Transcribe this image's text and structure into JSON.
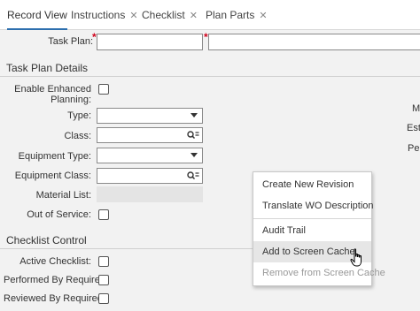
{
  "tabs": [
    {
      "label": "Record View",
      "active": true,
      "closable": false
    },
    {
      "label": "Instructions",
      "closable": true
    },
    {
      "label": "Checklist",
      "closable": true
    },
    {
      "label": "Plan Parts",
      "closable": true
    }
  ],
  "close_glyph": "✕",
  "task_plan": {
    "label": "Task Plan:",
    "required_mark": "*"
  },
  "sections": {
    "details": "Task Plan Details",
    "checklist": "Checklist Control"
  },
  "details": {
    "enable_enhanced": "Enable Enhanced Planning:",
    "type": "Type:",
    "class": "Class:",
    "equipment_type": "Equipment Type:",
    "equipment_class": "Equipment Class:",
    "material_list": "Material List:",
    "out_of_service": "Out of Service:"
  },
  "checklist": {
    "active": "Active Checklist:",
    "performed_by": "Performed By Required:",
    "reviewed_by": "Reviewed By Required:"
  },
  "right_cut_labels": [
    "M",
    "Esti",
    "Pe"
  ],
  "context_menu": {
    "items": [
      {
        "label": "Create New Revision",
        "state": "normal"
      },
      {
        "label": "Translate WO Description",
        "state": "normal"
      },
      {
        "label": "Audit Trail",
        "state": "normal"
      },
      {
        "label": "Add to Screen Cache",
        "state": "hover"
      },
      {
        "label": "Remove from Screen Cache",
        "state": "disabled"
      }
    ]
  },
  "colors": {
    "accent": "#2d6fae",
    "required": "#d0021b",
    "background": "#f2f2f2"
  },
  "icons": {
    "dropdown": "chevron-down-icon",
    "lookup": "lookup-search-icon",
    "cursor": "hand-pointer-icon"
  }
}
